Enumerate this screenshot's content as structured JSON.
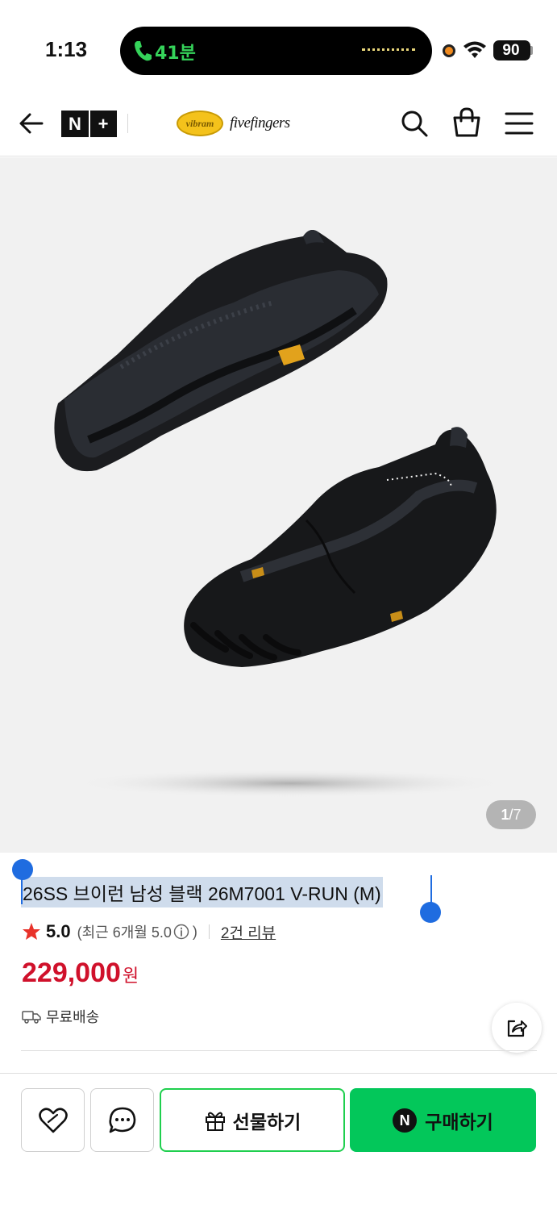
{
  "status_bar": {
    "time": "1:13",
    "call_duration": "41분",
    "battery": "90"
  },
  "header": {
    "nplus_n": "N",
    "nplus_plus": "+",
    "brand_badge": "vibram",
    "brand_name": "fivefingers"
  },
  "gallery": {
    "current": "1",
    "separator": "/",
    "total": "7"
  },
  "product": {
    "title": "26SS 브이런 남성 블랙 26M7001 V-RUN (M)",
    "rating_score": "5.0",
    "rating_recent": "(최근 6개월 5.0",
    "rating_recent_close": ")",
    "review_link": "2건 리뷰",
    "price": "229,000",
    "price_unit": "원",
    "shipping": "무료배송"
  },
  "actions": {
    "gift_label": "선물하기",
    "buy_icon_letter": "N",
    "buy_label": "구매하기"
  },
  "colors": {
    "accent_green": "#03c75a",
    "price_red": "#d0112b",
    "selection_blue": "#1f6ce0",
    "star_red": "#e8322a"
  }
}
